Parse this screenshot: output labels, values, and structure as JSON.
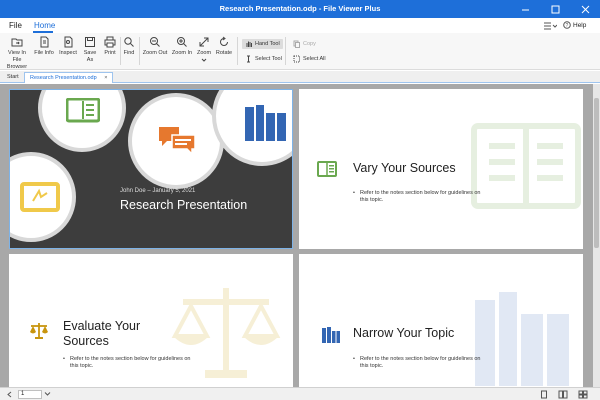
{
  "window": {
    "title": "Research Presentation.odp - File Viewer Plus"
  },
  "menu": {
    "items": [
      "File",
      "Home"
    ],
    "right_help": "Help"
  },
  "ribbon": {
    "view_in_file_browser": "View In File Browser",
    "file_info": "File Info",
    "inspect": "Inspect",
    "save_as": "Save As",
    "print": "Print",
    "find": "Find",
    "zoom_out": "Zoom Out",
    "zoom_in": "Zoom In",
    "zoom": "Zoom",
    "rotate": "Rotate",
    "hand_tool": "Hand Tool",
    "select_tool": "Select Tool",
    "copy": "Copy",
    "select_all": "Select All"
  },
  "tabs": [
    {
      "label": "Start"
    },
    {
      "label": "Research Presentation.odp"
    }
  ],
  "slides": {
    "s1": {
      "author": "John Doe – January 5, 2021",
      "title": "Research Presentation"
    },
    "s2": {
      "title": "Vary Your Sources",
      "bullet": "Refer to the notes section below for guidelines on this topic."
    },
    "s3": {
      "title": "Evaluate Your Sources",
      "bullet": "Refer to the notes section below for guidelines on this topic."
    },
    "s4": {
      "title": "Narrow Your Topic",
      "bullet": "Refer to the notes section below for guidelines on this topic."
    }
  },
  "status": {
    "page": "1"
  },
  "colors": {
    "accent": "#1e6fd9",
    "green": "#6aa84f",
    "orange": "#e6782e",
    "blue": "#3366b3",
    "yellow": "#f0c94a",
    "gold": "#c8950f"
  }
}
